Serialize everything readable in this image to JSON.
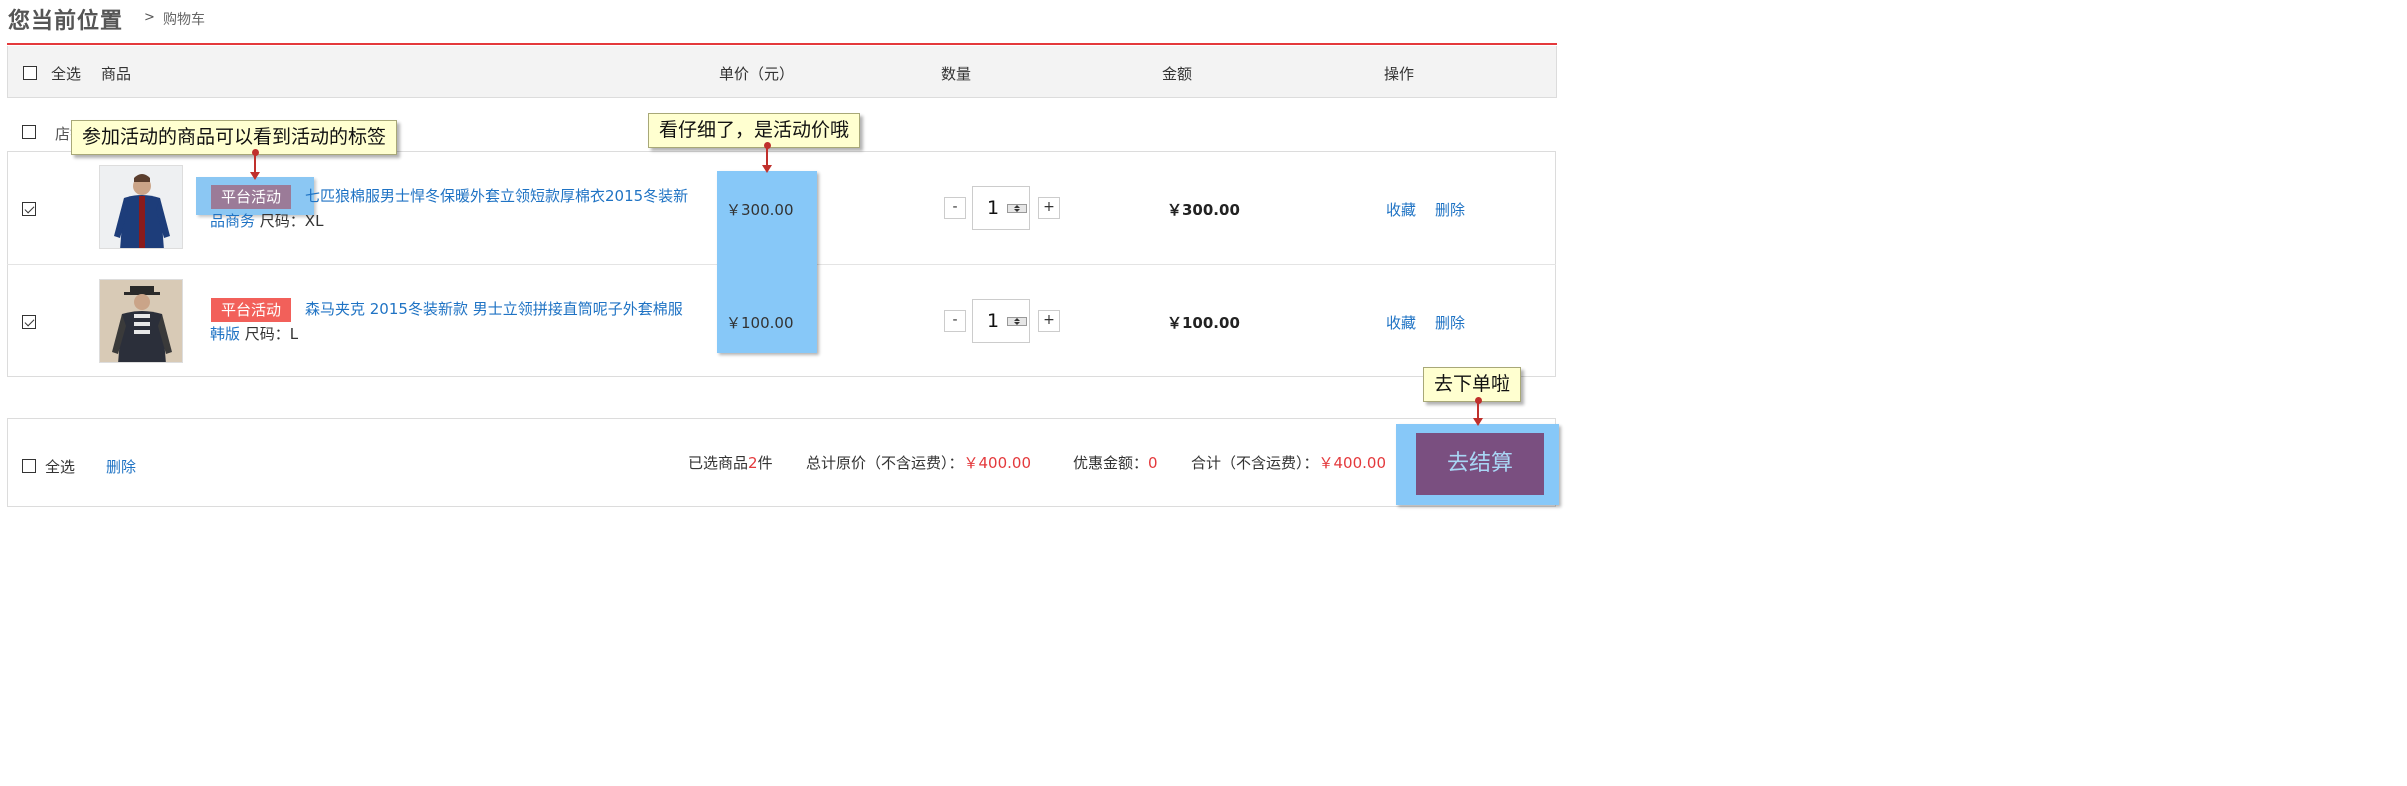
{
  "breadcrumb": {
    "title": "您当前位置",
    "separator": ">",
    "current": "购物车"
  },
  "table_header": {
    "select_all": "全选",
    "product": "商品",
    "unit_price": "单价（元）",
    "quantity": "数量",
    "amount": "金额",
    "actions": "操作"
  },
  "shop": {
    "label": "店铺"
  },
  "items": [
    {
      "checked": true,
      "tag": "平台活动",
      "title": "七匹狼棉服男士悍冬保暖外套立领短款厚棉衣2015冬装新品商务",
      "size_label": "尺码：XL",
      "price": "￥300.00",
      "quantity": "1",
      "amount": "￥300.00",
      "favorite": "收藏",
      "delete": "删除"
    },
    {
      "checked": true,
      "tag": "平台活动",
      "title": "森马夹克 2015冬装新款 男士立领拼接直筒呢子外套棉服韩版",
      "size_label": "尺码：L",
      "price": "￥100.00",
      "quantity": "1",
      "amount": "￥100.00",
      "favorite": "收藏",
      "delete": "删除"
    }
  ],
  "qty_controls": {
    "minus": "-",
    "plus": "+"
  },
  "footer": {
    "select_all": "全选",
    "delete": "删除",
    "selected_prefix": "已选商品",
    "selected_count": "2",
    "selected_suffix": "件",
    "original_total_label": "总计原价（不含运费）：",
    "original_total": "￥400.00",
    "discount_label": "优惠金额：",
    "discount": "0",
    "total_label": "合计（不含运费）：",
    "total": "￥400.00",
    "checkout": "去结算"
  },
  "tooltips": {
    "tag_hint": "参加活动的商品可以看到活动的标签",
    "price_hint": "看仔细了，是活动价哦",
    "checkout_hint": "去下单啦"
  },
  "colors": {
    "accent_red": "#e4393c",
    "link_blue": "#1f73c4",
    "tag_red": "#f2605a",
    "checkout_purple": "#7a4f80",
    "highlight_blue": "#87c8f8"
  }
}
